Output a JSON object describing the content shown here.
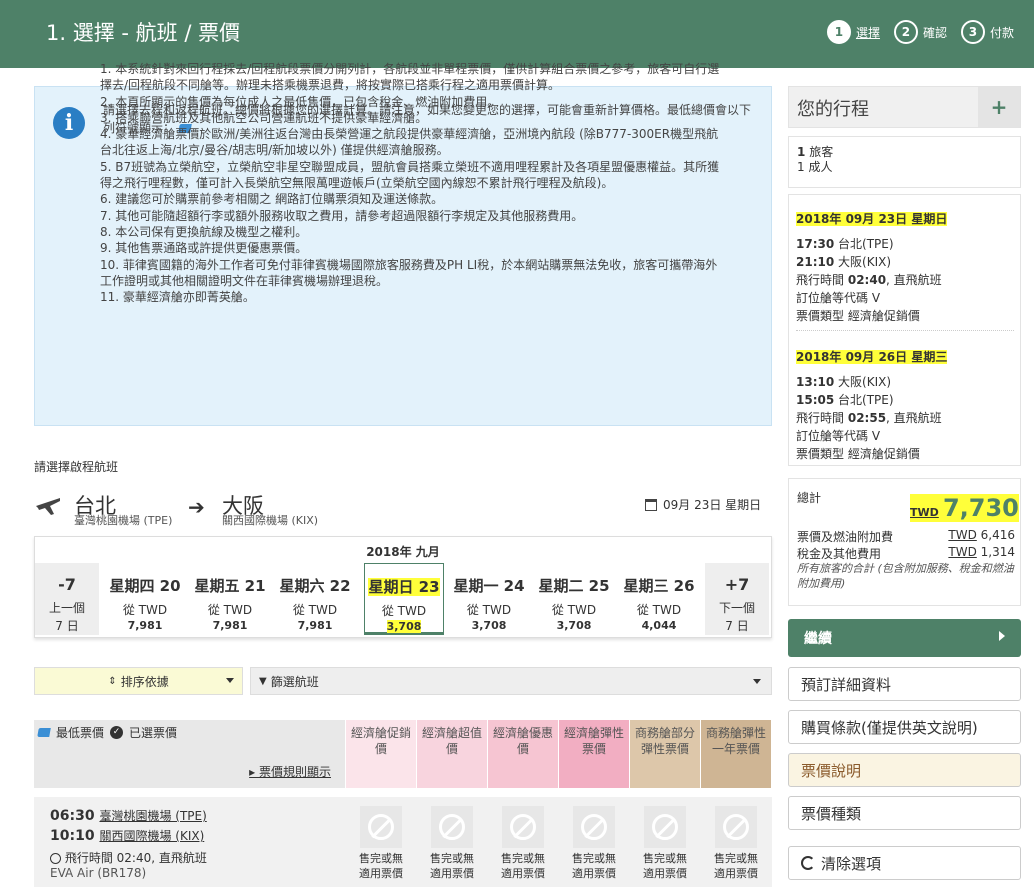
{
  "header": {
    "title": "1. 選擇 - 航班 / 票價",
    "steps": [
      {
        "num": "1",
        "label": "選擇"
      },
      {
        "num": "2",
        "label": "確認"
      },
      {
        "num": "3",
        "label": "付款"
      }
    ]
  },
  "info": {
    "intro": "請選擇去程和返程航班。總價將根據您的選擇計算。請注意，如果您變更您的選擇，可能會重新計算價格。最低總價會以下列符號顯示：",
    "items": [
      "1. 本系統針對來回行程採去/回程航段票價分開列計，各航段並非單程票價，僅供計算組合票價之參考，旅客可自行選擇去/回程航段不同艙等。辦理未搭乘機票退費，將按實際已搭乘行程之適用票價計算。",
      "2. 本頁所顯示的售價為每位成人之最低售價，已包含稅金、燃油附加費用。",
      "3. 搭乘聯營航班及其他航空公司營運航班不提供豪華經濟艙。",
      "4. 豪華經濟艙票價於歐洲/美洲往返台灣由長榮營運之航段提供豪華經濟艙，亞洲境內航段 (除B777-300ER機型飛航台北往返上海/北京/曼谷/胡志明/新加坡以外) 僅提供經濟艙服務。",
      "5. B7班號為立榮航空，立榮航空非星空聯盟成員，盟航會員搭乘立榮班不適用哩程累計及各項星盟優惠權益。其所獲得之飛行哩程數，僅可計入長榮航空無限萬哩遊帳戶(立榮航空國內線恕不累計飛行哩程及航段)。",
      "6. 建議您可於購票前參考相關之 網路訂位購票須知及運送條款。",
      "7. 其他可能隨超額行李或額外服務收取之費用，請參考超過限額行李規定及其他服務費用。",
      "8. 本公司保有更換航線及機型之權利。",
      "9. 其他售票通路或許提供更優惠票價。",
      "10. 菲律賓國籍的海外工作者可免付菲律賓機場國際旅客服務費及PH LI稅，於本網站購票無法免收，旅客可攜帶海外工作證明或其他相關證明文件在菲律賓機場辦理退稅。",
      "11. 豪華經濟艙亦即菁英艙。"
    ]
  },
  "outbound": {
    "prompt": "請選擇啟程航班",
    "from_city": "台北",
    "from_airport": "臺灣桃園機場 (TPE)",
    "to_city": "大阪",
    "to_airport": "關西國際機場 (KIX)",
    "date": "09月 23日 星期日",
    "month": "2018年 九月",
    "prev": {
      "label": "-7",
      "l1": "上一個",
      "l2": "7 日"
    },
    "next": {
      "label": "+7",
      "l1": "下一個",
      "l2": "7 日"
    },
    "days": [
      {
        "name": "星期四 20",
        "from": "從 TWD",
        "price": "7,981"
      },
      {
        "name": "星期五 21",
        "from": "從 TWD",
        "price": "7,981"
      },
      {
        "name": "星期六 22",
        "from": "從 TWD",
        "price": "7,981"
      },
      {
        "name": "星期日 23",
        "from": "從 TWD",
        "price": "3,708"
      },
      {
        "name": "星期一 24",
        "from": "從 TWD",
        "price": "3,708"
      },
      {
        "name": "星期二 25",
        "from": "從 TWD",
        "price": "3,708"
      },
      {
        "name": "星期三 26",
        "from": "從 TWD",
        "price": "4,044"
      }
    ],
    "sort_label": "排序依據",
    "filter_label": "篩選航班"
  },
  "fares": {
    "legend_lowest": "最低票價",
    "legend_selected": "已選票價",
    "rules_link": "票價規則顯示",
    "columns": [
      {
        "label": "經濟艙促銷價",
        "color": "#fbe4ea"
      },
      {
        "label": "經濟艙超值價",
        "color": "#f8d4de"
      },
      {
        "label": "經濟艙優惠價",
        "color": "#f6c5d2"
      },
      {
        "label": "經濟艙彈性票價",
        "color": "#f2aec2"
      },
      {
        "label": "商務艙部分彈性票價",
        "color": "#ddc7aa"
      },
      {
        "label": "商務艙彈性一年票價",
        "color": "#cfb594"
      }
    ]
  },
  "flight": {
    "dep_time": "06:30",
    "dep_airport": "臺灣桃園機場 (TPE)",
    "arr_time": "10:10",
    "arr_airport": "關西國際機場 (KIX)",
    "duration": "飛行時間 02:40, 直飛航班",
    "carrier": "EVA Air (BR178)",
    "soldout_l1": "售完或無",
    "soldout_l2": "適用票價"
  },
  "sidebar": {
    "title": "您的行程",
    "pax_count": "1",
    "pax_label": "旅客",
    "pax_type": "1 成人",
    "segments": [
      {
        "date_strong": "2018年 09月 23日",
        "date_weekday": "星期日",
        "dep_time": "17:30",
        "dep_city": "台北(TPE)",
        "arr_time": "21:10",
        "arr_city": "大阪(KIX)",
        "duration_pre": "飛行時間",
        "duration_val": "02:40",
        "duration_post": ", 直飛航班",
        "class": "訂位艙等代碼 V",
        "fare": "票價類型 經濟艙促銷價"
      },
      {
        "date_strong": "2018年 09月 26日",
        "date_weekday": "星期三",
        "dep_time": "13:10",
        "dep_city": "大阪(KIX)",
        "arr_time": "15:05",
        "arr_city": "台北(TPE)",
        "duration_pre": "飛行時間",
        "duration_val": "02:55",
        "duration_post": ", 直飛航班",
        "class": "訂位艙等代碼 V",
        "fare": "票價類型 經濟艙促銷價"
      }
    ],
    "total_label": "總計",
    "total_currency": "TWD",
    "total_amount": "7,730",
    "fare_fuel_label": "票價及燃油附加費",
    "fare_fuel_cur": "TWD",
    "fare_fuel_val": "6,416",
    "tax_label": "稅金及其他費用",
    "tax_cur": "TWD",
    "tax_val": "1,314",
    "note": "所有旅客的合計 (包含附加服務、稅金和燃油附加費用)",
    "continue": "繼續",
    "links": [
      "預訂詳細資料",
      "購買條款(僅提供英文說明)",
      "票價說明",
      "票價種類"
    ],
    "clear": "清除選項"
  }
}
